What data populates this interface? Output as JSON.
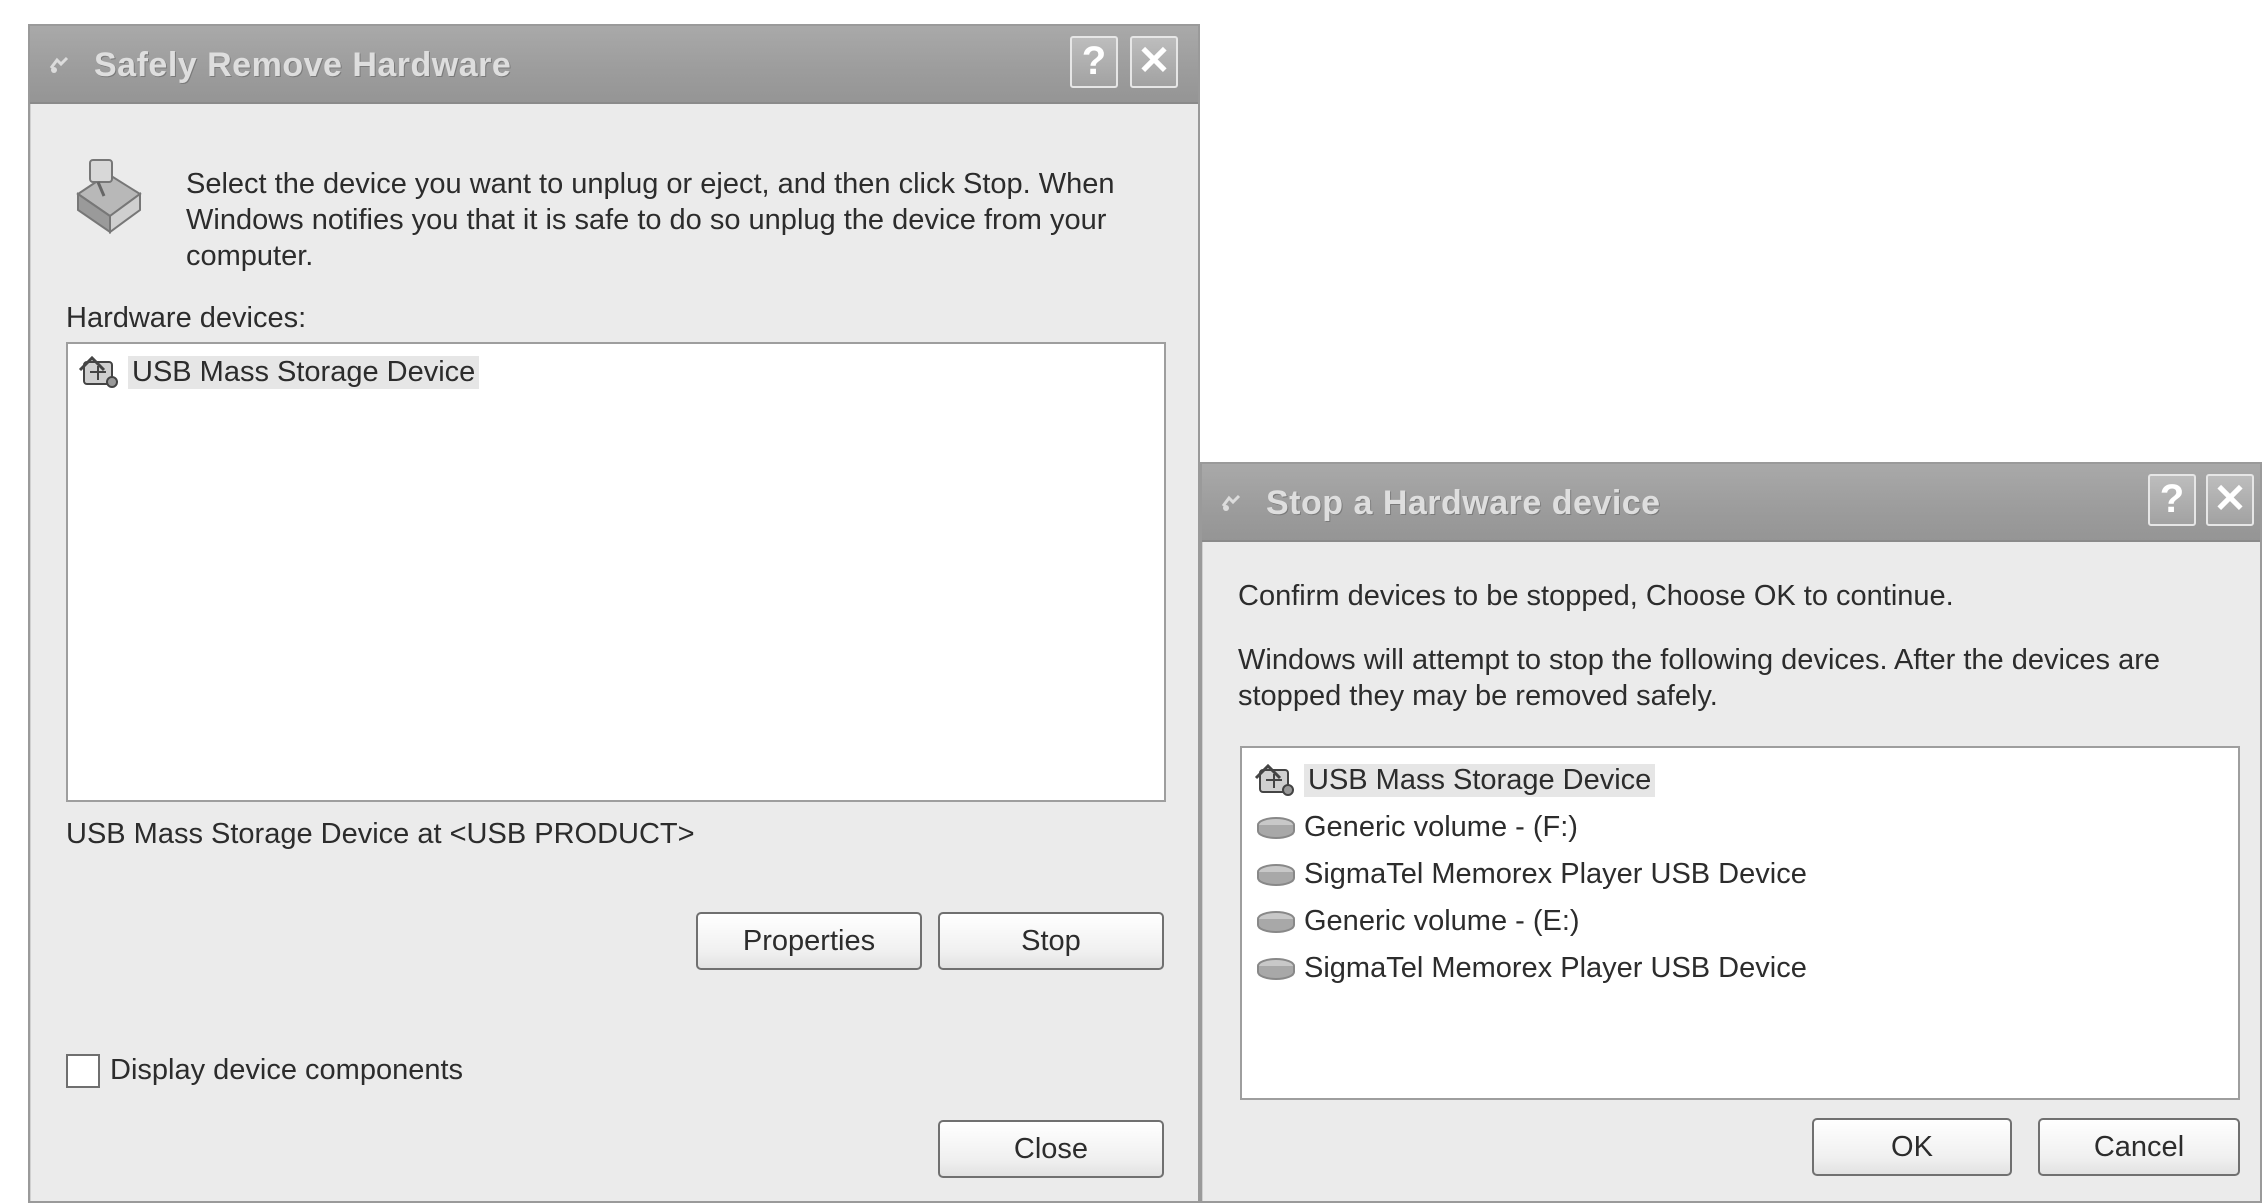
{
  "safely_remove": {
    "title": "Safely Remove Hardware",
    "help_button": "?",
    "close_button": "✕",
    "instructions_line1": "Select the device you want to unplug or eject, and then click Stop. When",
    "instructions_line2": "Windows notifies you that it is safe to do so unplug the device from your",
    "instructions_line3": "computer.",
    "devices_label": "Hardware devices:",
    "devices": [
      {
        "label": "USB Mass Storage Device",
        "icon": "usb-device-icon",
        "selected": true
      }
    ],
    "status_text": "USB Mass Storage Device at <USB PRODUCT>",
    "properties_label": "Properties",
    "stop_label": "Stop",
    "display_components_label": "Display device components",
    "display_components_checked": false,
    "close_label": "Close"
  },
  "stop_device": {
    "title": "Stop a Hardware device",
    "help_button": "?",
    "close_button": "✕",
    "confirm_text": "Confirm devices to be stopped, Choose OK to continue.",
    "info_line1": "Windows will attempt to stop the following devices. After the devices are",
    "info_line2": "stopped they may be removed safely.",
    "devices": [
      {
        "label": "USB Mass Storage Device",
        "icon": "usb-device-icon"
      },
      {
        "label": "Generic volume - (F:)",
        "icon": "drive-icon"
      },
      {
        "label": "SigmaTel Memorex Player USB Device",
        "icon": "drive-icon"
      },
      {
        "label": "Generic volume - (E:)",
        "icon": "drive-icon"
      },
      {
        "label": "SigmaTel Memorex Player USB Device",
        "icon": "drive-icon"
      }
    ],
    "ok_label": "OK",
    "cancel_label": "Cancel"
  },
  "colors": {
    "dialog_bg": "#ebebeb",
    "titlebar": "#9c9c9c",
    "title_text": "#dedede"
  }
}
